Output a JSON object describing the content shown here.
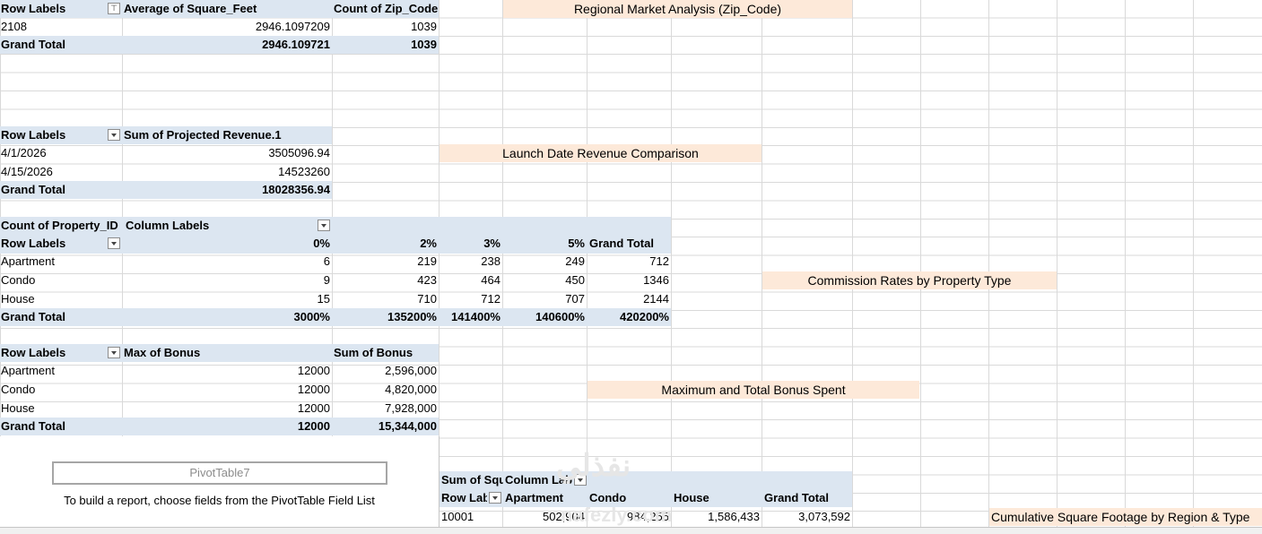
{
  "pivot1": {
    "row_labels": "Row Labels",
    "avg_header": "Average of Square_Feet",
    "count_header": "Count of Zip_Code",
    "rows": [
      {
        "label": "2108",
        "avg": "2946.1097209",
        "count": "1039"
      }
    ],
    "grand_total": {
      "label": "Grand Total",
      "avg": "2946.109721",
      "count": "1039"
    }
  },
  "pivot2": {
    "row_labels": "Row Labels",
    "value_header": "Sum of Projected Revenue.1",
    "rows": [
      {
        "label": "4/1/2026",
        "value": "3505096.94"
      },
      {
        "label": "4/15/2026",
        "value": "14523260"
      }
    ],
    "grand_total": {
      "label": "Grand Total",
      "value": "18028356.94"
    }
  },
  "pivot3": {
    "corner": "Count of Property_ID",
    "column_labels": "Column Labels",
    "row_labels": "Row Labels",
    "columns": [
      "0%",
      "2%",
      "3%",
      "5%",
      "Grand Total"
    ],
    "rows": [
      {
        "label": "Apartment",
        "values": [
          "6",
          "219",
          "238",
          "249",
          "712"
        ]
      },
      {
        "label": "Condo",
        "values": [
          "9",
          "423",
          "464",
          "450",
          "1346"
        ]
      },
      {
        "label": "House",
        "values": [
          "15",
          "710",
          "712",
          "707",
          "2144"
        ]
      }
    ],
    "grand_total": {
      "label": "Grand Total",
      "values": [
        "3000%",
        "135200%",
        "141400%",
        "140600%",
        "420200%"
      ]
    }
  },
  "pivot4": {
    "row_labels": "Row Labels",
    "max_header": "Max of Bonus",
    "sum_header": "Sum of Bonus",
    "rows": [
      {
        "label": "Apartment",
        "max": "12000",
        "sum": "2,596,000"
      },
      {
        "label": "Condo",
        "max": "12000",
        "sum": "4,820,000"
      },
      {
        "label": "House",
        "max": "12000",
        "sum": "7,928,000"
      }
    ],
    "grand_total": {
      "label": "Grand Total",
      "max": "12000",
      "sum": "15,344,000"
    }
  },
  "pivot5": {
    "corner": "Sum of Squ",
    "column_labels": "Column Lab",
    "row_labels": "Row Lab",
    "columns": [
      "Apartment",
      "Condo",
      "House",
      "Grand Total"
    ],
    "rows": [
      {
        "label": "10001",
        "values": [
          "502,904",
          "984,255",
          "1,586,433",
          "3,073,592"
        ]
      }
    ]
  },
  "titles": {
    "regional": "Regional Market Analysis (Zip_Code)",
    "launch": "Launch Date Revenue Comparison",
    "commission": "Commission Rates by Property Type",
    "bonus": "Maximum and Total Bonus Spent",
    "cumulative": "Cumulative Square Footage by Region & Type"
  },
  "placeholder": {
    "name": "PivotTable7",
    "hint": "To build a report, choose fields from the PivotTable Field List"
  },
  "watermark": {
    "arabic": "نفذلي",
    "latin": "nafezly.com"
  },
  "colors": {
    "header_bg": "#dce6f1",
    "title_bg": "#fde9d9",
    "grid": "#d9d9d9"
  }
}
